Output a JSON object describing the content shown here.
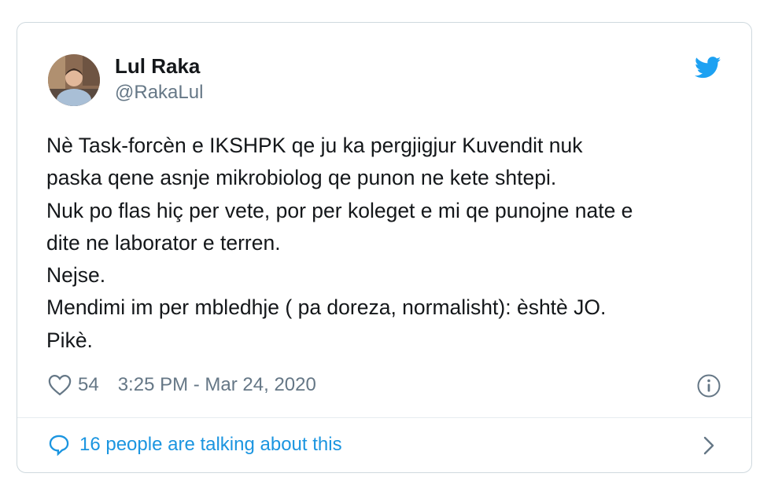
{
  "tweet": {
    "display_name": "Lul Raka",
    "handle": "@RakaLul",
    "text_lines": [
      "Nè Task-forcèn e IKSHPK qe ju ka pergjigjur Kuvendit nuk",
      "paska qene asnje mikrobiolog qe punon ne kete shtepi.",
      "Nuk po flas hiç per vete, por per koleget e mi qe punojne nate e",
      "dite ne laborator e terren.",
      "Nejse.",
      "Mendimi im per mbledhje ( pa doreza, normalisht): èshtè JO.",
      "Pikè."
    ],
    "likes": "54",
    "timestamp": "3:25 PM - Mar 24, 2020",
    "talking_text": "16 people are talking about this"
  },
  "icons": {
    "brand": "twitter-bird-icon",
    "like": "heart-icon",
    "info": "info-icon",
    "reply": "speech-bubble-icon",
    "more": "chevron-right-icon"
  },
  "colors": {
    "brand_blue": "#1da1f2",
    "link_blue": "#1b95e0",
    "text": "#14171a",
    "muted": "#657786",
    "border": "#cfd9de"
  }
}
